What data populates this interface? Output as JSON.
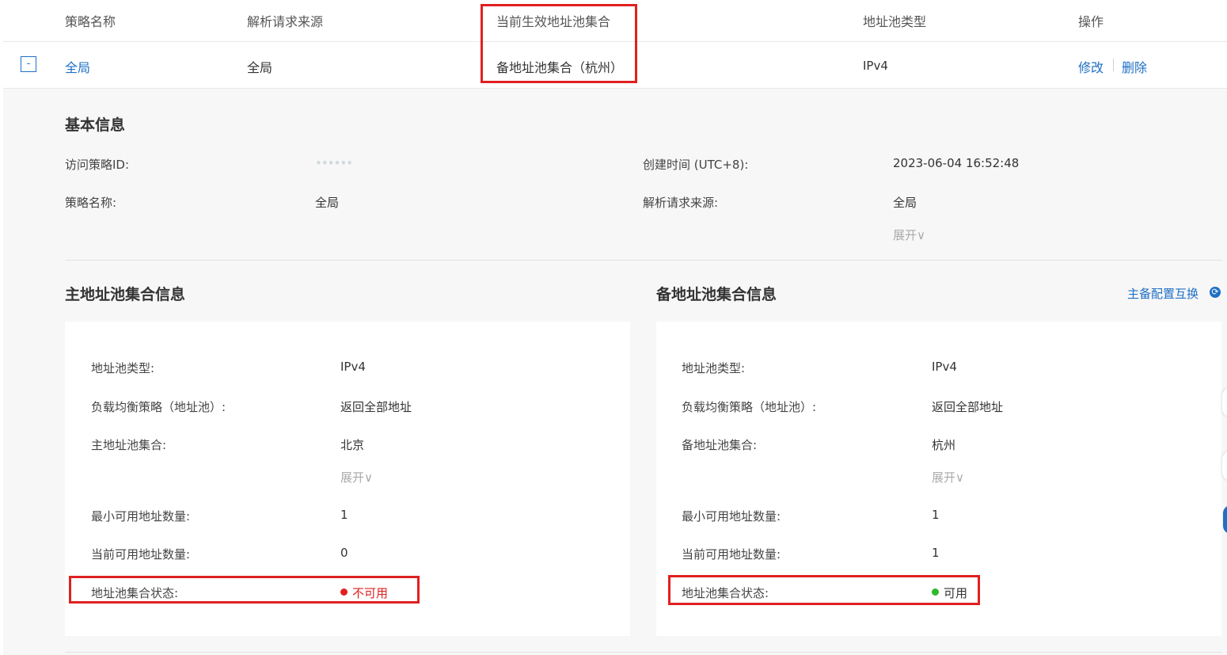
{
  "table": {
    "headers": {
      "policy_name": "策略名称",
      "request_source": "解析请求来源",
      "active_pool_set": "当前生效地址池集合",
      "pool_type": "地址池类型",
      "actions": "操作"
    },
    "row": {
      "expand_toggle": "-",
      "policy_name": "全局",
      "request_source": "全局",
      "active_pool_set": "备地址池集合（杭州）",
      "pool_type": "IPv4",
      "edit": "修改",
      "delete": "删除"
    }
  },
  "basic_info": {
    "title": "基本信息",
    "policy_id_label": "访问策略ID:",
    "policy_id_value": "••••••",
    "created_label": "创建时间 (UTC+8):",
    "created_value": "2023-06-04 16:52:48",
    "name_label": "策略名称:",
    "name_value": "全局",
    "source_label": "解析请求来源:",
    "source_value": "全局",
    "expand": "展开∨"
  },
  "primary": {
    "title": "主地址池集合信息",
    "type_label": "地址池类型:",
    "type_value": "IPv4",
    "lb_label": "负载均衡策略（地址池）:",
    "lb_value": "返回全部地址",
    "set_label": "主地址池集合:",
    "set_value": "北京",
    "expand": "展开∨",
    "min_label": "最小可用地址数量:",
    "min_value": "1",
    "cur_label": "当前可用地址数量:",
    "cur_value": "0",
    "status_label": "地址池集合状态:",
    "status_value": "不可用",
    "status_color": "#e02020"
  },
  "backup": {
    "title": "备地址池集合信息",
    "swap_link": "主备配置互换",
    "type_label": "地址池类型:",
    "type_value": "IPv4",
    "lb_label": "负载均衡策略（地址池）:",
    "lb_value": "返回全部地址",
    "set_label": "备地址池集合:",
    "set_value": "杭州",
    "expand": "展开∨",
    "min_label": "最小可用地址数量:",
    "min_value": "1",
    "cur_label": "当前可用地址数量:",
    "cur_value": "1",
    "status_label": "地址池集合状态:",
    "status_value": "可用",
    "status_color": "#2eb82e"
  },
  "colors": {
    "link": "#1f6fc5",
    "highlight_box": "#e02020",
    "panel_bg": "#f7f7f7"
  }
}
